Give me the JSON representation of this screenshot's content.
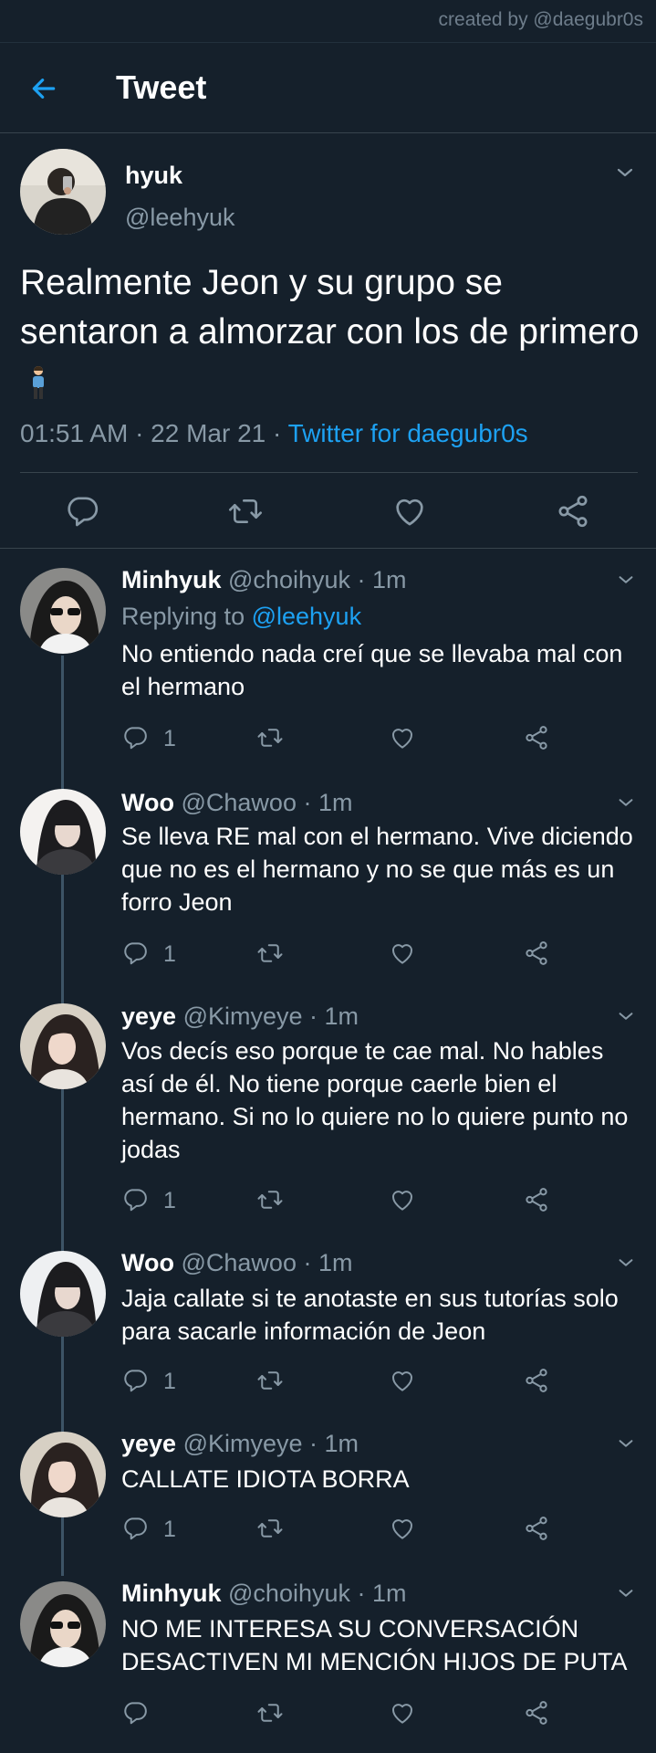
{
  "watermark": "created by @daegubr0s",
  "header": {
    "title": "Tweet"
  },
  "main_tweet": {
    "name": "hyuk",
    "handle": "@leehyuk",
    "text": "Realmente Jeon y su grupo se sentaron a almorzar con los de primero",
    "time": "01:51 AM · 22 Mar 21 · ",
    "client": "Twitter for daegubr0s"
  },
  "replies": [
    {
      "name": "Minhyuk",
      "meta": " @choihyuk · 1m",
      "replying_label": "Replying to ",
      "replying_to": "@leehyuk",
      "text": "No entiendo nada creí que se llevaba mal con el hermano",
      "reply_count": "1"
    },
    {
      "name": "Woo",
      "meta": " @Chawoo · 1m",
      "text": "Se lleva RE mal con el hermano. Vive diciendo que no es el hermano y no se que más es un forro Jeon",
      "reply_count": "1"
    },
    {
      "name": "yeye",
      "meta": " @Kimyeye · 1m",
      "text": "Vos decís eso porque te cae mal. No hables así de él. No tiene porque caerle bien el hermano. Si no lo quiere no lo quiere punto no jodas",
      "reply_count": "1"
    },
    {
      "name": "Woo",
      "meta": " @Chawoo · 1m",
      "text": "Jaja callate si te anotaste en sus tutorías solo para sacarle información de Jeon",
      "reply_count": "1"
    },
    {
      "name": "yeye",
      "meta": " @Kimyeye · 1m",
      "text": "CALLATE IDIOTA BORRA",
      "reply_count": "1"
    },
    {
      "name": "Minhyuk",
      "meta": " @choihyuk · 1m",
      "text": "NO ME INTERESA SU CONVERSACIÓN DESACTIVEN MI MENCIÓN HIJOS DE PUTA",
      "reply_count": ""
    }
  ],
  "icons": {
    "back": "arrow-left-icon",
    "more": "chevron-down-icon",
    "reply": "speech-bubble-icon",
    "retweet": "retweet-icon",
    "like": "heart-icon",
    "share": "share-icon",
    "emoji": "person-emoji"
  },
  "colors": {
    "background": "#15202b",
    "accent": "#1da1f2",
    "muted": "#8899a6",
    "divider": "#38444d",
    "thread": "#3d5466"
  }
}
